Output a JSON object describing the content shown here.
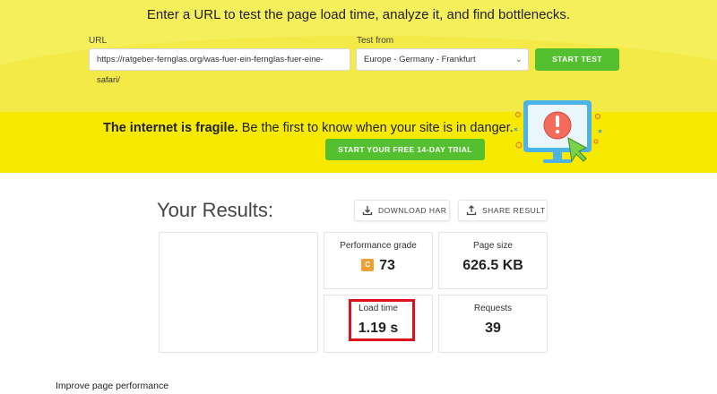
{
  "header": {
    "headline": "Enter a URL to test the page load time, analyze it, and find bottlenecks.",
    "url_label": "URL",
    "url_value": "https://ratgeber-fernglas.org/was-fuer-ein-fernglas-fuer-eine-safari/",
    "test_from_label": "Test from",
    "test_from_value": "Europe - Germany - Frankfurt",
    "start_test_label": "START TEST"
  },
  "banner": {
    "bold_text": "The internet is fragile.",
    "text": " Be the first to know when your site is in danger.",
    "cta_label": "START YOUR FREE 14-DAY TRIAL"
  },
  "results": {
    "title": "Your Results:",
    "download_har_label": "DOWNLOAD HAR",
    "share_result_label": "SHARE RESULT",
    "performance_grade_label": "Performance grade",
    "performance_grade_letter": "C",
    "performance_grade_value": "73",
    "page_size_label": "Page size",
    "page_size_value": "626.5 KB",
    "load_time_label": "Load time",
    "load_time_value": "1.19 s",
    "requests_label": "Requests",
    "requests_value": "39"
  },
  "footer": {
    "improve_label": "Improve page performance"
  },
  "colors": {
    "yellow_top": "#f5ef5c",
    "yellow_banner": "#f7ea00",
    "green": "#55c02f",
    "grade_orange": "#f0a030",
    "highlight_red": "#e0101a"
  }
}
